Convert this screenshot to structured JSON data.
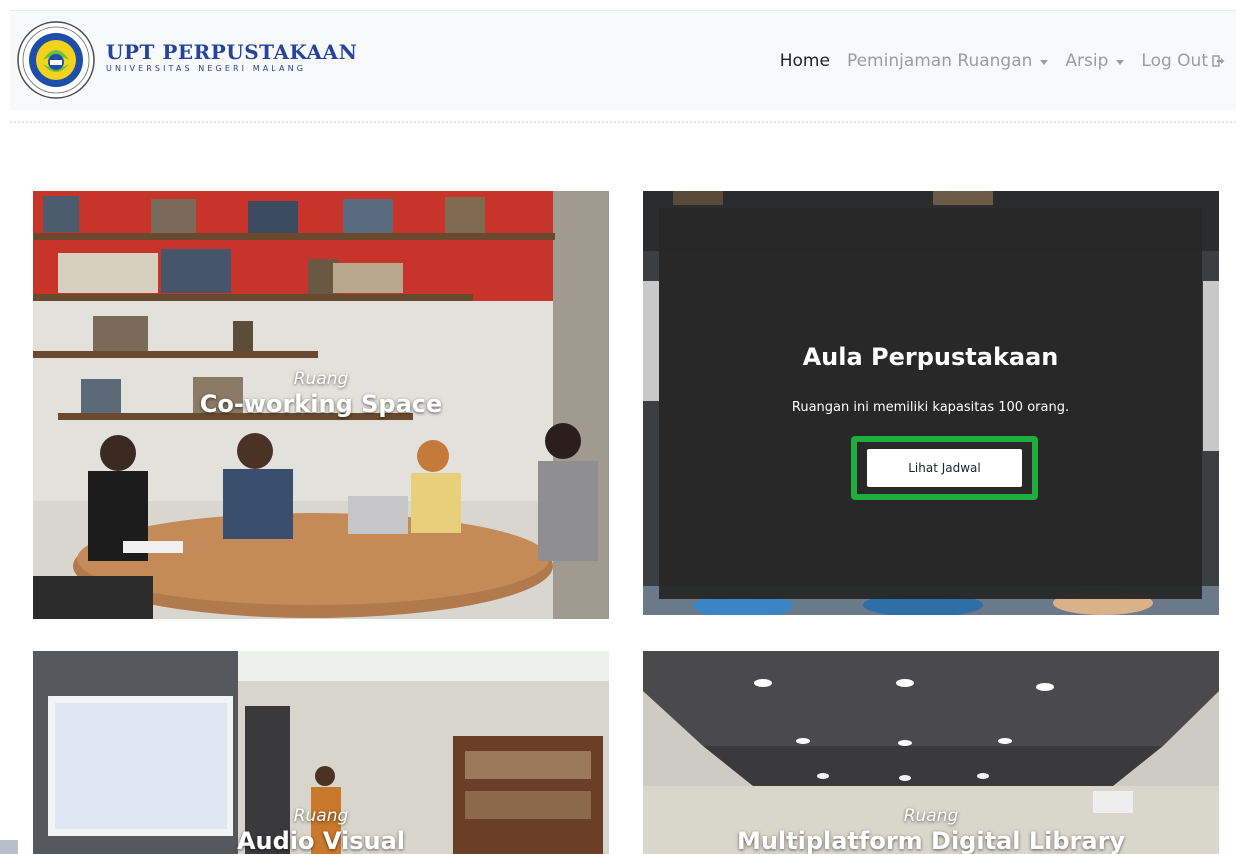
{
  "brand": {
    "title": "UPT PERPUSTAKAAN",
    "subtitle": "UNIVERSITAS NEGERI MALANG",
    "logo_icon": "university-seal-icon",
    "colors": {
      "brand_blue": "#27449c"
    }
  },
  "nav": {
    "home": "Home",
    "peminjaman": "Peminjaman Ruangan",
    "arsip": "Arsip",
    "logout": "Log Out"
  },
  "cards": [
    {
      "small": "Ruang",
      "big": "Co-working Space"
    },
    {
      "title": "Aula Perpustakaan",
      "description": "Ruangan ini memiliki kapasitas 100 orang.",
      "button": "Lihat Jadwal",
      "highlight_color": "#1fae3e"
    },
    {
      "small": "Ruang",
      "big": "Audio Visual"
    },
    {
      "small": "Ruang",
      "big": "Multiplatform Digital Library"
    }
  ]
}
